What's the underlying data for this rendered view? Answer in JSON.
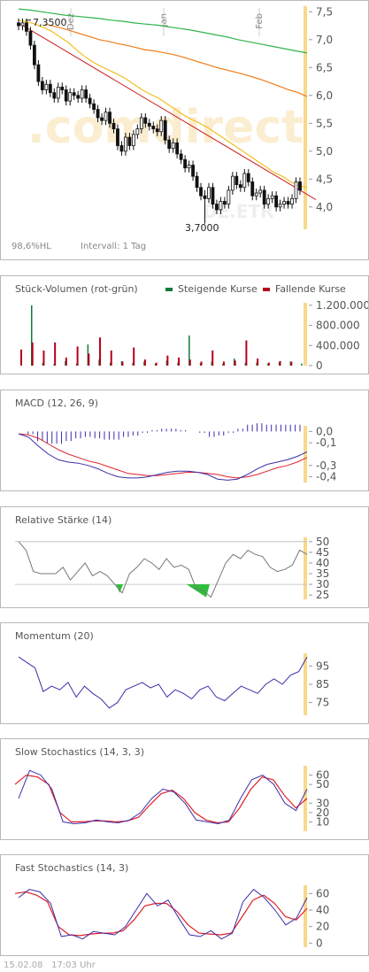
{
  "colors": {
    "hl": "#f7d98a",
    "up": "#127a3a",
    "down": "#b5001b",
    "indigo": "#3b2ea8",
    "red": "#e0202a",
    "rsi": "#777777",
    "green": "#2dbf3a",
    "ma38": "#f0c020",
    "ma100": "#f07d1a",
    "ma200": "#2db44a",
    "trend": "#cc2222",
    "grid": "#dddddd",
    "axis": "#555555"
  },
  "watermark": {
    "text": ".comdirect",
    "sub": "DE.ETR"
  },
  "footer": {
    "date": "15.02.08",
    "time": "17:03 Uhr"
  },
  "main": {
    "months": [
      "Dez",
      "Jan",
      "Feb"
    ],
    "high_label": "7,3500",
    "low_label": "3,7000",
    "perf_label": "98,6%HL",
    "interval_label": "Intervall: 1 Tag",
    "ticks": [
      "7,5",
      "7,0",
      "6,5",
      "6,0",
      "5,5",
      "5,0",
      "4,5",
      "4,0"
    ]
  },
  "volume": {
    "title": "Stück-Volumen (rot-grün)",
    "legend_up": "Steigende Kurse",
    "legend_down": "Fallende Kurse",
    "ticks": [
      "1.200.000",
      "800.000",
      "400.000",
      "0"
    ]
  },
  "macd": {
    "title": "MACD (12, 26, 9)",
    "ticks": [
      "0,0",
      "-0,1",
      "-0,3",
      "-0,4"
    ]
  },
  "rsi": {
    "title": "Relative Stärke (14)",
    "ticks": [
      "50",
      "45",
      "40",
      "35",
      "30",
      "25"
    ]
  },
  "momentum": {
    "title": "Momentum (20)",
    "ticks": [
      "95",
      "85",
      "75"
    ]
  },
  "slow": {
    "title": "Slow Stochastics (14, 3, 3)",
    "ticks": [
      "60",
      "50",
      "30",
      "20",
      "10"
    ]
  },
  "fast": {
    "title": "Fast Stochastics (14, 3)",
    "ticks": [
      "60",
      "40",
      "20",
      "0"
    ]
  },
  "chart_data": [
    {
      "type": "candlestick",
      "title": "",
      "ylim": [
        3.6,
        7.6
      ],
      "y_ticks": [
        7.5,
        7.0,
        6.5,
        6.0,
        5.5,
        5.0,
        4.5,
        4.0
      ],
      "x_labels": [
        "Dez",
        "Jan",
        "Feb"
      ],
      "annotations": [
        "7,3500",
        "3,7000"
      ],
      "close": [
        7.25,
        7.3,
        7.15,
        6.9,
        6.55,
        6.25,
        6.1,
        6.2,
        6.05,
        5.95,
        6.15,
        6.1,
        5.9,
        6.05,
        6.0,
        5.95,
        6.1,
        5.95,
        5.85,
        5.75,
        5.6,
        5.55,
        5.7,
        5.5,
        5.4,
        5.1,
        5.0,
        5.25,
        5.1,
        5.3,
        5.4,
        5.6,
        5.5,
        5.45,
        5.4,
        5.35,
        5.55,
        5.2,
        5.05,
        5.15,
        4.95,
        4.85,
        4.7,
        4.75,
        4.55,
        4.35,
        4.2,
        4.15,
        4.35,
        4.05,
        3.95,
        4.1,
        4.05,
        4.3,
        4.55,
        4.4,
        4.35,
        4.6,
        4.45,
        4.2,
        4.25,
        4.3,
        4.05,
        4.15,
        4.2,
        4.0,
        4.05,
        4.1,
        4.05,
        4.15,
        4.45,
        4.3
      ],
      "ma38": [
        7.35,
        7.32,
        7.28,
        7.22,
        7.15,
        7.05,
        6.95,
        6.82,
        6.7,
        6.6,
        6.52,
        6.45,
        6.38,
        6.3,
        6.2,
        6.1,
        6.02,
        5.95,
        5.85,
        5.75,
        5.65,
        5.57,
        5.5,
        5.42,
        5.32,
        5.22,
        5.12,
        5.02,
        4.92,
        4.82,
        4.72,
        4.62,
        4.55,
        4.45,
        4.38,
        4.35
      ],
      "ma100": [
        7.28,
        7.24,
        7.2,
        7.15,
        7.1,
        7.05,
        7.0,
        6.97,
        6.93,
        6.9,
        6.86,
        6.82,
        6.8,
        6.77,
        6.74,
        6.7,
        6.65,
        6.6,
        6.55,
        6.5,
        6.46,
        6.42,
        6.38,
        6.33,
        6.28,
        6.22,
        6.16,
        6.1,
        6.05,
        5.98
      ],
      "ma200": [
        7.55,
        7.53,
        7.5,
        7.47,
        7.44,
        7.42,
        7.4,
        7.38,
        7.35,
        7.33,
        7.3,
        7.28,
        7.26,
        7.23,
        7.2,
        7.17,
        7.13,
        7.09,
        7.05,
        7.0,
        6.96,
        6.92,
        6.88,
        6.84,
        6.8,
        6.76
      ],
      "trendline": [
        7.3,
        4.13
      ]
    },
    {
      "type": "bar",
      "title": "Stück-Volumen (rot-grün)",
      "ylim": [
        0,
        1250000
      ],
      "series": [
        {
          "name": "Steigende Kurse",
          "values": [
            1200000,
            60000,
            30000,
            90000,
            40000,
            420000,
            120000,
            60000,
            90000,
            60000,
            80000,
            40000,
            100000,
            60000,
            600000,
            50000,
            80000,
            40000,
            140000,
            60000,
            60000,
            40000,
            70000,
            80000,
            40000
          ]
        },
        {
          "name": "Fallende Kurse",
          "values": [
            320000,
            460000,
            300000,
            460000,
            160000,
            380000,
            240000,
            560000,
            300000,
            80000,
            360000,
            120000,
            60000,
            200000,
            160000,
            120000,
            80000,
            300000,
            80000,
            100000,
            500000,
            140000,
            60000,
            90000,
            80000
          ]
        }
      ]
    },
    {
      "type": "line",
      "title": "MACD (12, 26, 9)",
      "ylim": [
        -0.45,
        0.05
      ],
      "series": [
        {
          "name": "MACD",
          "values": [
            -0.02,
            -0.05,
            -0.13,
            -0.2,
            -0.25,
            -0.27,
            -0.28,
            -0.3,
            -0.33,
            -0.37,
            -0.4,
            -0.41,
            -0.41,
            -0.4,
            -0.38,
            -0.36,
            -0.35,
            -0.35,
            -0.36,
            -0.38,
            -0.42,
            -0.43,
            -0.42,
            -0.38,
            -0.33,
            -0.29,
            -0.27,
            -0.25,
            -0.22,
            -0.18
          ]
        },
        {
          "name": "Signal",
          "values": [
            -0.02,
            -0.03,
            -0.06,
            -0.11,
            -0.16,
            -0.2,
            -0.23,
            -0.26,
            -0.28,
            -0.31,
            -0.34,
            -0.37,
            -0.38,
            -0.39,
            -0.39,
            -0.38,
            -0.37,
            -0.36,
            -0.36,
            -0.37,
            -0.38,
            -0.4,
            -0.41,
            -0.4,
            -0.38,
            -0.35,
            -0.32,
            -0.3,
            -0.27,
            -0.23
          ]
        }
      ]
    },
    {
      "type": "line",
      "title": "Relative Stärke (14)",
      "ylim": [
        23,
        52
      ],
      "series": [
        {
          "name": "RSI",
          "values": [
            50,
            46,
            36,
            35,
            35,
            35,
            38,
            32,
            36,
            40,
            34,
            36,
            34,
            30,
            26,
            35,
            38,
            42,
            40,
            37,
            42,
            38,
            39,
            37,
            28,
            27,
            24,
            32,
            40,
            44,
            42,
            46,
            44,
            43,
            38,
            36,
            37,
            39,
            46,
            44
          ]
        }
      ]
    },
    {
      "type": "line",
      "title": "Momentum (20)",
      "ylim": [
        68,
        102
      ],
      "series": [
        {
          "name": "Momentum",
          "values": [
            100,
            97,
            94,
            81,
            84,
            82,
            86,
            78,
            84,
            80,
            77,
            72,
            75,
            82,
            84,
            86,
            83,
            85,
            78,
            82,
            80,
            77,
            82,
            84,
            78,
            76,
            80,
            84,
            82,
            80,
            85,
            88,
            85,
            90,
            92,
            100
          ]
        }
      ]
    },
    {
      "type": "line",
      "title": "Slow Stochastics (14, 3, 3)",
      "ylim": [
        0,
        70
      ],
      "series": [
        {
          "name": "%K",
          "values": [
            35,
            65,
            60,
            45,
            10,
            8,
            9,
            12,
            10,
            9,
            12,
            20,
            35,
            45,
            42,
            30,
            12,
            10,
            8,
            12,
            35,
            55,
            60,
            50,
            30,
            22,
            45
          ]
        },
        {
          "name": "%D",
          "values": [
            50,
            60,
            58,
            50,
            20,
            10,
            10,
            11,
            11,
            10,
            11,
            15,
            28,
            40,
            44,
            35,
            20,
            12,
            9,
            10,
            25,
            45,
            58,
            55,
            38,
            25,
            35
          ]
        }
      ]
    },
    {
      "type": "line",
      "title": "Fast Stochastics (14, 3)",
      "ylim": [
        -5,
        70
      ],
      "series": [
        {
          "name": "%K",
          "values": [
            55,
            65,
            62,
            48,
            8,
            10,
            5,
            14,
            12,
            10,
            20,
            40,
            60,
            45,
            52,
            30,
            10,
            8,
            15,
            5,
            12,
            50,
            65,
            55,
            40,
            22,
            30,
            55
          ]
        },
        {
          "name": "%D",
          "values": [
            60,
            62,
            58,
            50,
            20,
            10,
            9,
            11,
            12,
            12,
            15,
            28,
            45,
            48,
            48,
            38,
            22,
            12,
            11,
            10,
            12,
            32,
            52,
            58,
            48,
            32,
            28,
            42
          ]
        }
      ]
    }
  ]
}
